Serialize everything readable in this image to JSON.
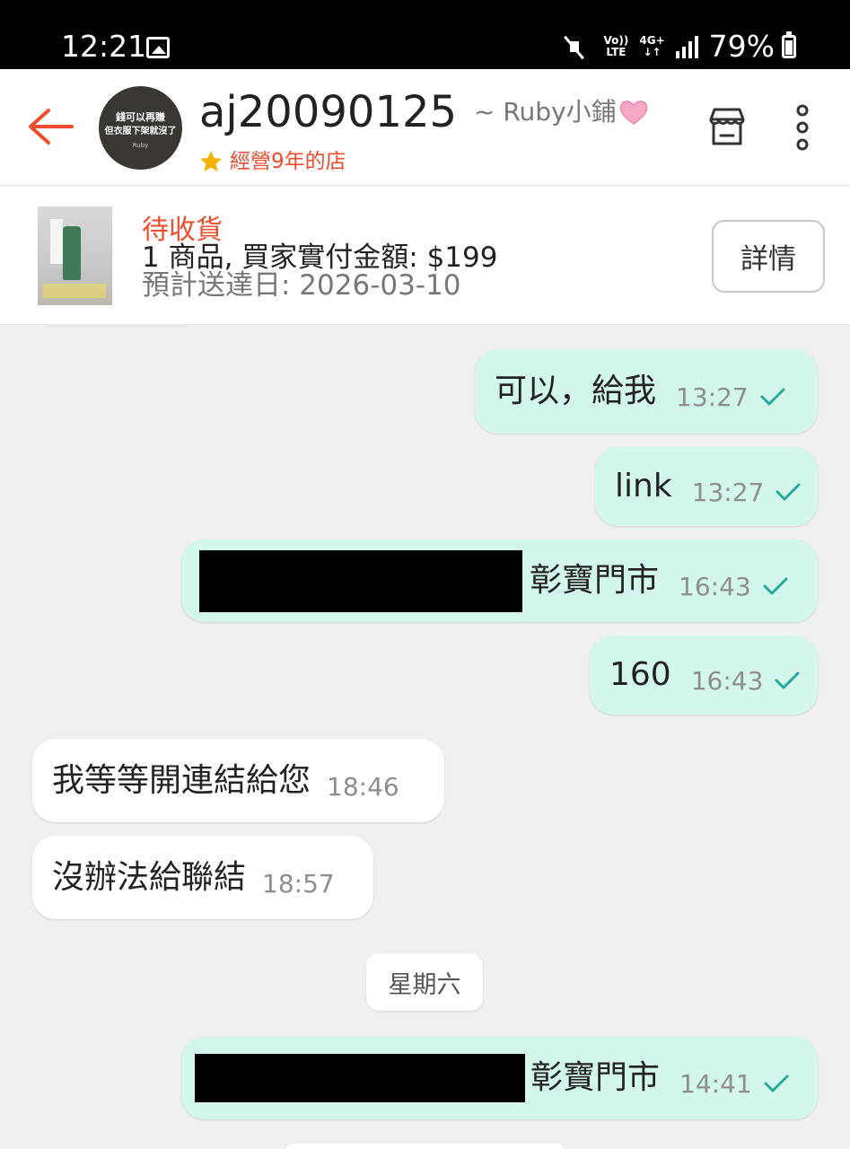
{
  "status_bar": {
    "time": "12:21",
    "volte_top": "Vo))",
    "volte_bottom": "LTE",
    "network_top": "4G+",
    "network_bottom": "↓↑",
    "battery": "79%"
  },
  "header": {
    "shop_name": "aj20090125",
    "shop_nickname": "~ Ruby小鋪",
    "shop_age": "經營9年的店",
    "avatar_text_line1": "錢可以再賺",
    "avatar_text_line2": "但衣服下架就沒了",
    "avatar_tag": "Ruby"
  },
  "order": {
    "status": "待收貨",
    "summary": "1 商品, 買家實付金額: $199",
    "eta": "預計送達日: 2026-03-10",
    "detail_label": "詳情"
  },
  "messages": [
    {
      "direction": "out",
      "text": "可以，給我",
      "time": "13:27",
      "read": true
    },
    {
      "direction": "out",
      "text": "link",
      "time": "13:27",
      "read": true
    },
    {
      "direction": "out",
      "text": "彰寶門市",
      "time": "16:43",
      "read": true,
      "redacted_prefix": true
    },
    {
      "direction": "out",
      "text": "160",
      "time": "16:43",
      "read": true
    },
    {
      "direction": "in",
      "text": "我等等開連結給您",
      "time": "18:46"
    },
    {
      "direction": "in",
      "text": "沒辦法給聯結",
      "time": "18:57"
    },
    {
      "direction": "out",
      "text": "彰寶門市",
      "time": "14:41",
      "read": true,
      "redacted_prefix": true
    }
  ],
  "day_separator": "星期六",
  "colors": {
    "accent": "#ee4d2d",
    "outgoing_bubble": "#d3f7ec",
    "incoming_bubble": "#ffffff",
    "check": "#26aa99",
    "chat_background": "#f0f0f0"
  },
  "icons": [
    "back-arrow-icon",
    "star-icon",
    "heart-icon",
    "store-icon",
    "more-vertical-icon",
    "check-icon",
    "gallery-icon",
    "mute-icon",
    "signal-icon",
    "battery-icon"
  ]
}
